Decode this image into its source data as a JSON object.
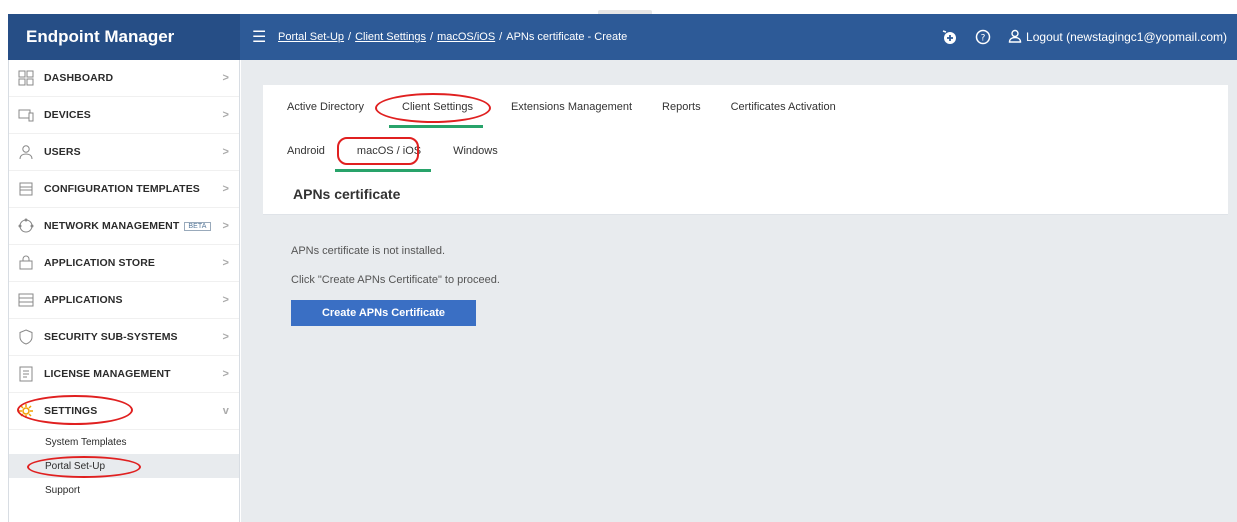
{
  "app": {
    "title": "Endpoint Manager"
  },
  "breadcrumbs": {
    "items": [
      "Portal Set-Up",
      "Client Settings",
      "macOS/iOS"
    ],
    "sep": "/",
    "current": "APNs certificate - Create"
  },
  "header": {
    "logout_label": "Logout (newstagingc1@yopmail.com)"
  },
  "sidebar": {
    "items": [
      {
        "label": "DASHBOARD",
        "icon": "dashboard-icon"
      },
      {
        "label": "DEVICES",
        "icon": "devices-icon"
      },
      {
        "label": "USERS",
        "icon": "users-icon"
      },
      {
        "label": "CONFIGURATION TEMPLATES",
        "icon": "configuration-icon"
      },
      {
        "label": "NETWORK MANAGEMENT",
        "icon": "network-icon",
        "badge": "BETA"
      },
      {
        "label": "APPLICATION STORE",
        "icon": "store-icon"
      },
      {
        "label": "APPLICATIONS",
        "icon": "applications-icon"
      },
      {
        "label": "SECURITY SUB-SYSTEMS",
        "icon": "shield-icon"
      },
      {
        "label": "LICENSE MANAGEMENT",
        "icon": "license-icon"
      },
      {
        "label": "SETTINGS",
        "icon": "gear-icon"
      }
    ],
    "settings_sub": [
      "System Templates",
      "Portal Set-Up",
      "Support"
    ]
  },
  "tabs": {
    "primary": [
      "Active Directory",
      "Client Settings",
      "Extensions Management",
      "Reports",
      "Certificates Activation"
    ],
    "secondary": [
      "Android",
      "macOS / iOS",
      "Windows"
    ]
  },
  "main": {
    "section_title": "APNs certificate",
    "message1": "APNs certificate is not installed.",
    "message2": "Click \"Create APNs Certificate\" to proceed.",
    "create_button": "Create APNs Certificate"
  },
  "colors": {
    "header": "#2d5a97",
    "accent": "#28a36a",
    "button": "#3a6fc4",
    "annotation": "#e02020"
  }
}
